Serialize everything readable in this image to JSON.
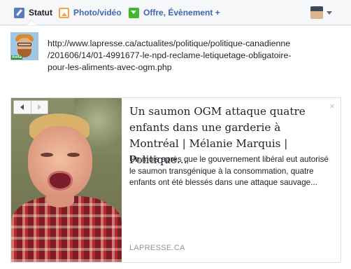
{
  "tabs": [
    {
      "label": "Statut",
      "icon": "pencil-icon"
    },
    {
      "label": "Photo/vidéo",
      "icon": "photo-icon"
    },
    {
      "label": "Offre, Évènement +",
      "icon": "flag-icon"
    }
  ],
  "colors": {
    "link_blue": "#4267b2",
    "muted_gray": "#90949c",
    "border": "#dddfe2"
  },
  "post": {
    "text": "http://www.lapresse.ca/actualites/politique/politique-canadienne\n/201606/14/01-4991677-le-npd-reclame-letiquetage-obligatoire-\npour-les-aliments-avec-ogm.php",
    "author_badge": "meta"
  },
  "link_preview": {
    "title": "Un saumon OGM attaque quatre enfants dans une garderie à Montréal | Mélanie Marquis | Politique...",
    "description": "Un mois après que le gouvernement libéral eut autorisé le saumon transgénique à la consommation, quatre enfants ont été blessés dans une attaque sauvage...",
    "domain": "LAPRESSE.CA",
    "close_glyph": "×"
  }
}
